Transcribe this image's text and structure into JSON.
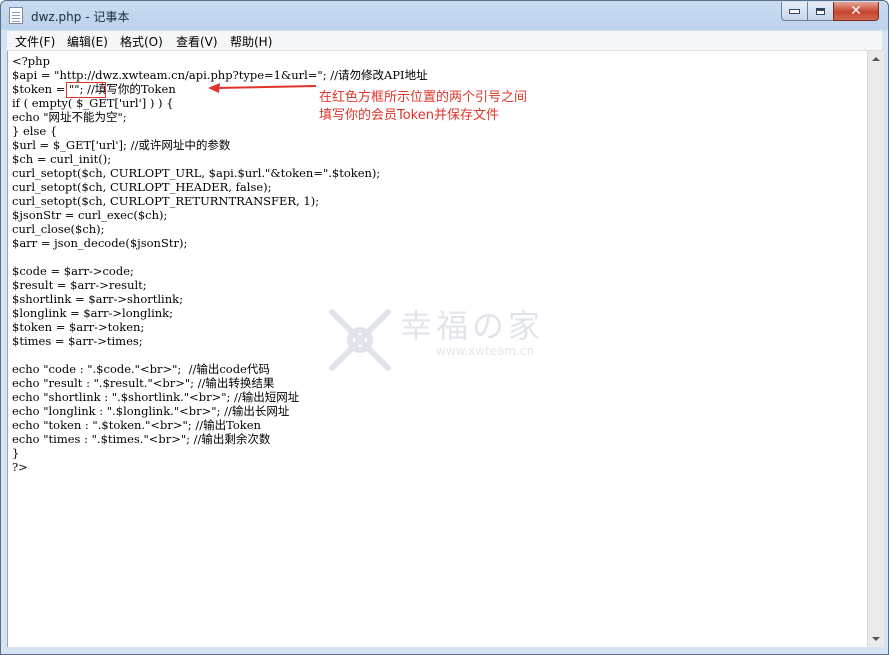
{
  "window": {
    "title": "dwz.php - 记事本"
  },
  "menu": [
    "文件(F)",
    "编辑(E)",
    "格式(O)",
    "查看(V)",
    "帮助(H)"
  ],
  "code_lines": [
    "<?php",
    "$api = \"http://dwz.xwteam.cn/api.php?type=1&url=\"; //请勿修改API地址",
    "$token = \"\"; //填写你的Token",
    "if ( empty( $_GET['url'] ) ) {",
    "echo \"网址不能为空\";",
    "} else {",
    "$url = $_GET['url']; //或许网址中的参数",
    "$ch = curl_init();",
    "curl_setopt($ch, CURLOPT_URL, $api.$url.\"&token=\".$token);",
    "curl_setopt($ch, CURLOPT_HEADER, false);",
    "curl_setopt($ch, CURLOPT_RETURNTRANSFER, 1);",
    "$jsonStr = curl_exec($ch);",
    "curl_close($ch);",
    "$arr = json_decode($jsonStr);",
    "",
    "$code = $arr->code;",
    "$result = $arr->result;",
    "$shortlink = $arr->shortlink;",
    "$longlink = $arr->longlink;",
    "$token = $arr->token;",
    "$times = $arr->times;",
    "",
    "echo \"code : \".$code.\"<br>\";  //输出code代码",
    "echo \"result : \".$result.\"<br>\"; //输出转换结果",
    "echo \"shortlink : \".$shortlink.\"<br>\"; //输出短网址",
    "echo \"longlink : \".$longlink.\"<br>\"; //输出长网址",
    "echo \"token : \".$token.\"<br>\"; //输出Token",
    "echo \"times : \".$times.\"<br>\"; //输出剩余次数",
    "}",
    "?>"
  ],
  "annotation": {
    "line1": "在红色方框所示位置的两个引号之间",
    "line2": "填写你的会员Token并保存文件",
    "color": "#e0342a"
  },
  "watermark": {
    "text": "幸福の家",
    "url": "www.xwteam.cn"
  },
  "icons": {
    "app": "notepad-icon",
    "minimize": "minimize-icon",
    "maximize": "maximize-icon",
    "close": "close-icon"
  }
}
